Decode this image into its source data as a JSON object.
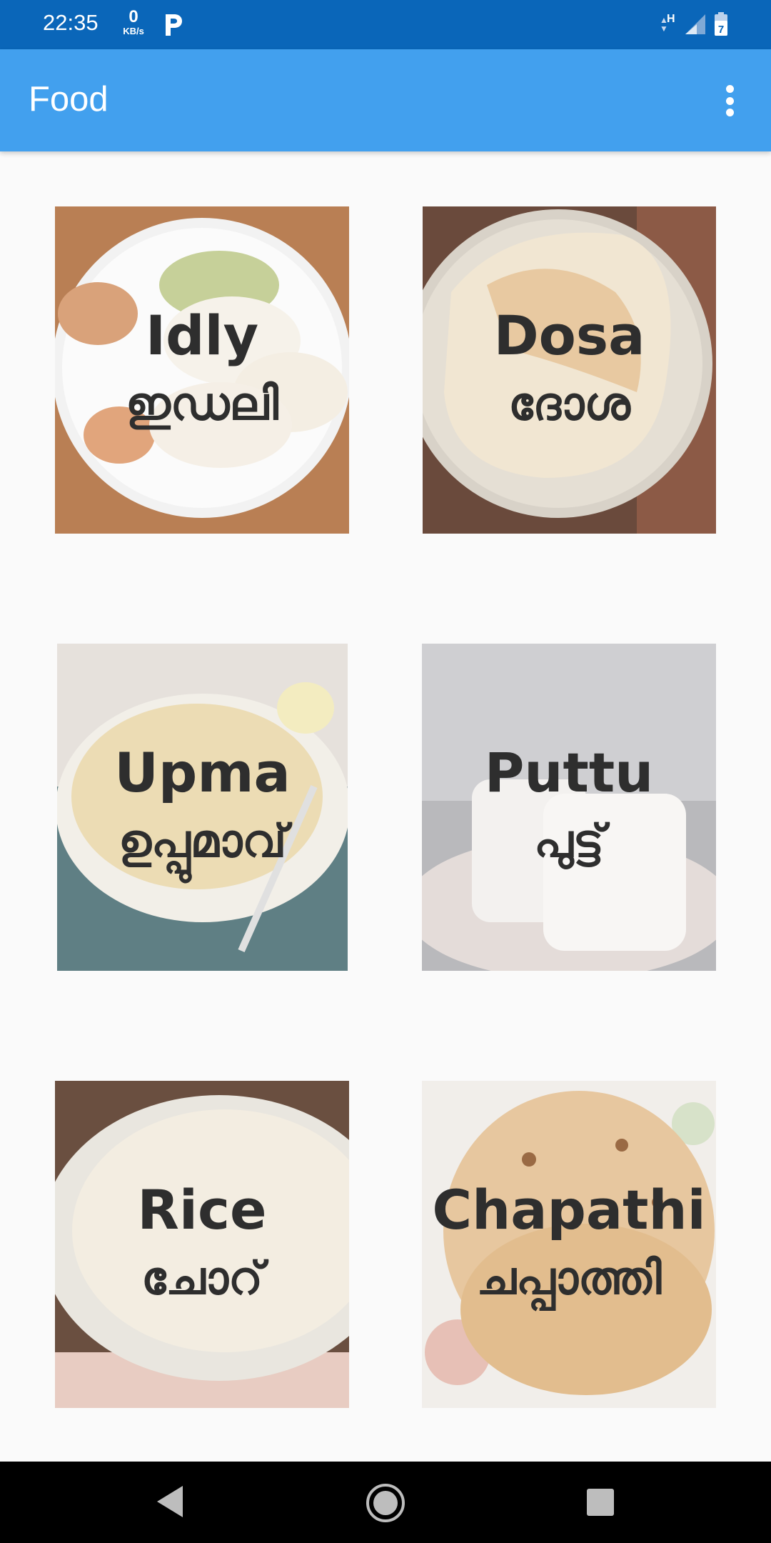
{
  "status_bar": {
    "time": "22:35",
    "speed_value": "0",
    "speed_unit": "KB/s",
    "network": "H",
    "battery_level": "7"
  },
  "app_bar": {
    "title": "Food"
  },
  "foods": [
    {
      "english": "Idly",
      "malayalam": "ഇഡലി"
    },
    {
      "english": "Dosa",
      "malayalam": "ദോശ"
    },
    {
      "english": "Upma",
      "malayalam": "ഉപ്പുമാവ്"
    },
    {
      "english": "Puttu",
      "malayalam": "പുട്ട്"
    },
    {
      "english": "Rice",
      "malayalam": "ചോറ്"
    },
    {
      "english": "Chapathi",
      "malayalam": "ചപ്പാത്തി"
    }
  ],
  "colors": {
    "status_bar": "#0a66b9",
    "app_bar": "#42a0ee",
    "background": "#fafafa",
    "label_text": "#2e2e2e"
  }
}
